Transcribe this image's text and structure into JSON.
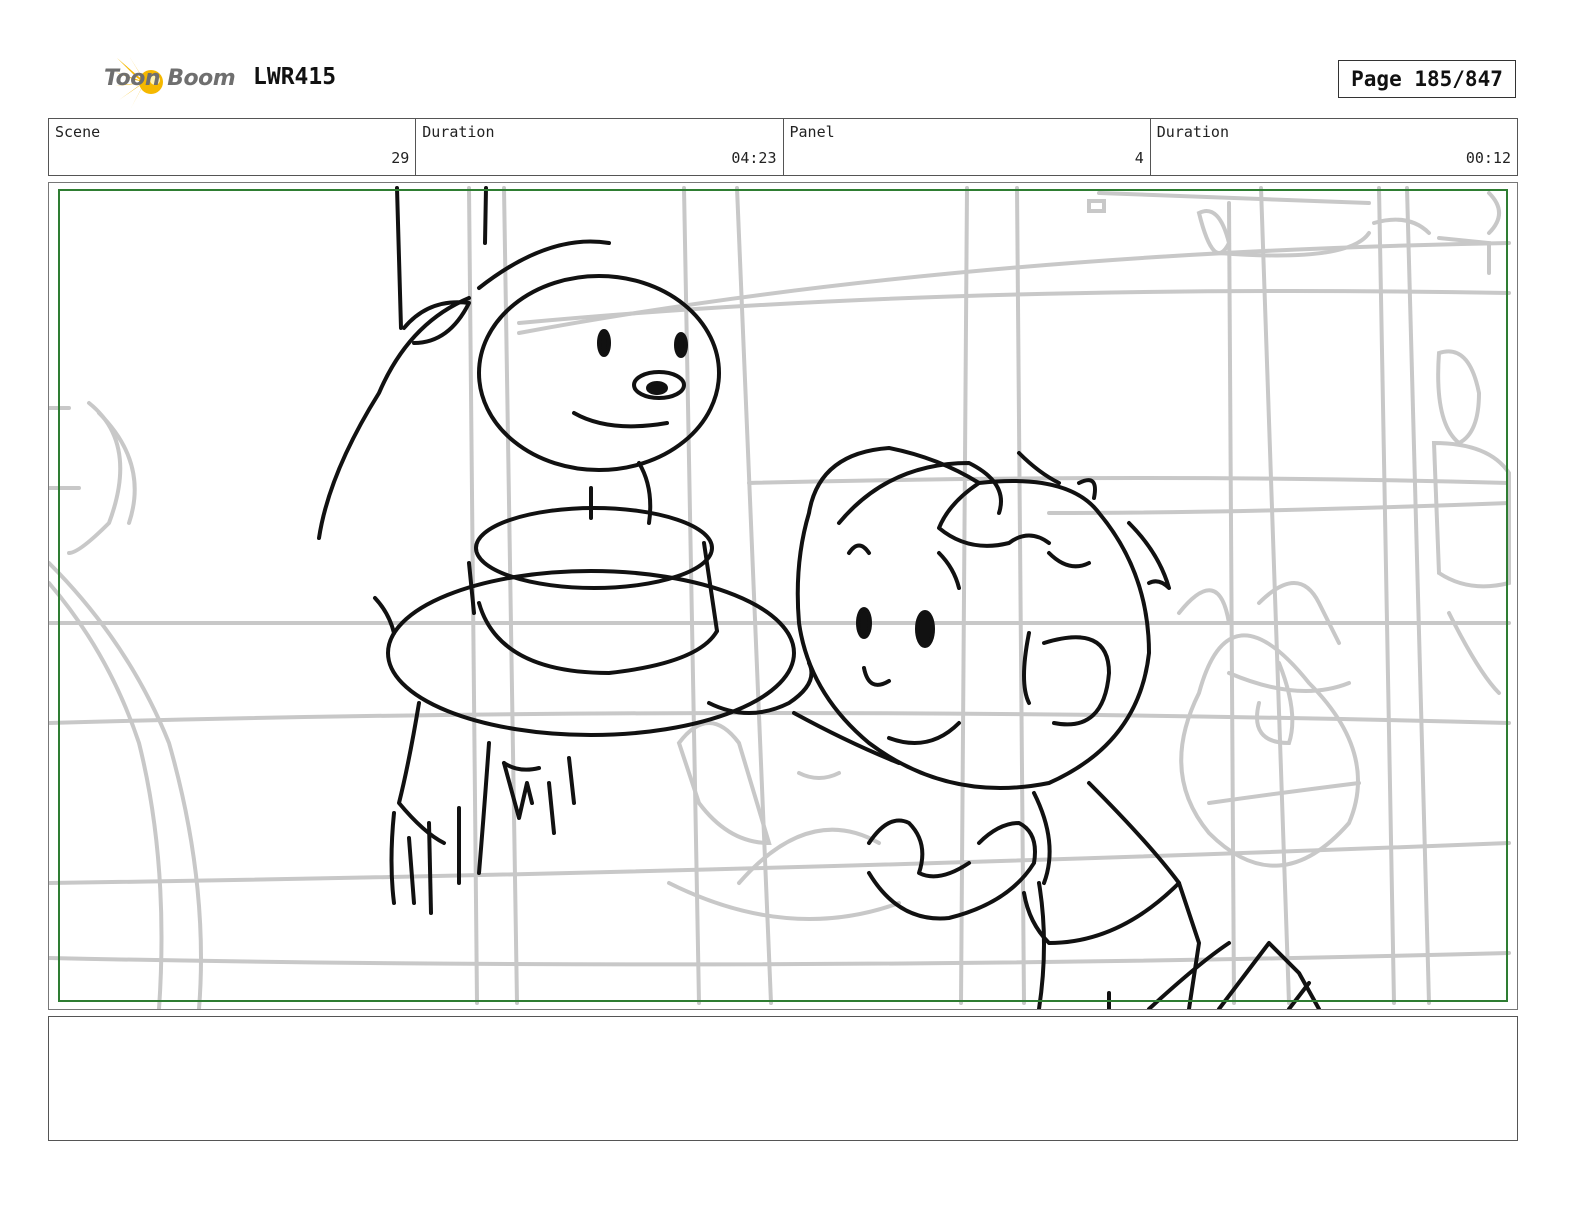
{
  "header": {
    "logo_text": "Toon Boom",
    "project_code": "LWR415",
    "page_label": "Page 185/847"
  },
  "info": {
    "scene_label": "Scene",
    "scene_value": "29",
    "scene_duration_label": "Duration",
    "scene_duration_value": "04:23",
    "panel_label": "Panel",
    "panel_value": "4",
    "panel_duration_label": "Duration",
    "panel_duration_value": "00:12"
  },
  "colors": {
    "logo_star": "#f5b800",
    "safe_frame": "#2e7d32",
    "sketch_dark": "#111111",
    "sketch_light": "#c4c4c4"
  },
  "notes": {
    "text": ""
  }
}
